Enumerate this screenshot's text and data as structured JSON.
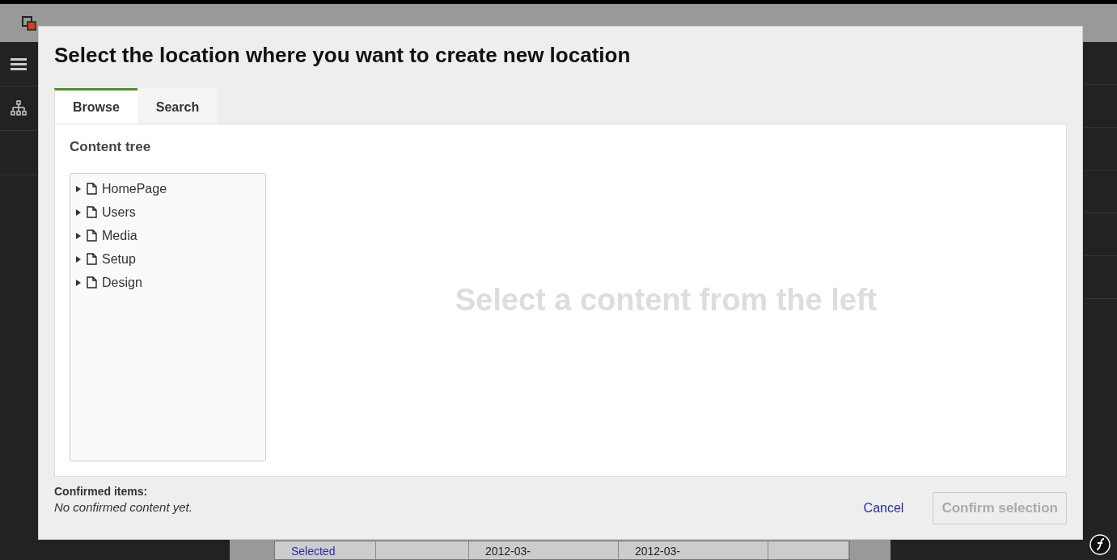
{
  "background": {
    "table_row": [
      {
        "text": "Selected",
        "kind": "link"
      },
      {
        "kind": "cell"
      },
      {
        "text": "2012-03-",
        "kind": "cell"
      },
      {
        "text": "2012-03-",
        "kind": "cell"
      },
      {
        "kind": "cell"
      }
    ]
  },
  "modal": {
    "title": "Select the location where you want to create new location",
    "tabs": [
      {
        "label": "Browse",
        "selected": true
      },
      {
        "label": "Search",
        "selected": false
      }
    ],
    "tree_heading": "Content tree",
    "tree": [
      {
        "label": "HomePage",
        "expanded": false
      },
      {
        "label": "Users",
        "expanded": false
      },
      {
        "label": "Media",
        "expanded": false
      },
      {
        "label": "Setup",
        "expanded": false
      },
      {
        "label": "Design",
        "expanded": false
      }
    ],
    "placeholder": "Select a content from the left",
    "confirmed_label": "Confirmed items:",
    "confirmed_empty": "No confirmed content yet.",
    "cancel": "Cancel",
    "confirm": {
      "label": "Confirm selection",
      "disabled": true
    }
  }
}
